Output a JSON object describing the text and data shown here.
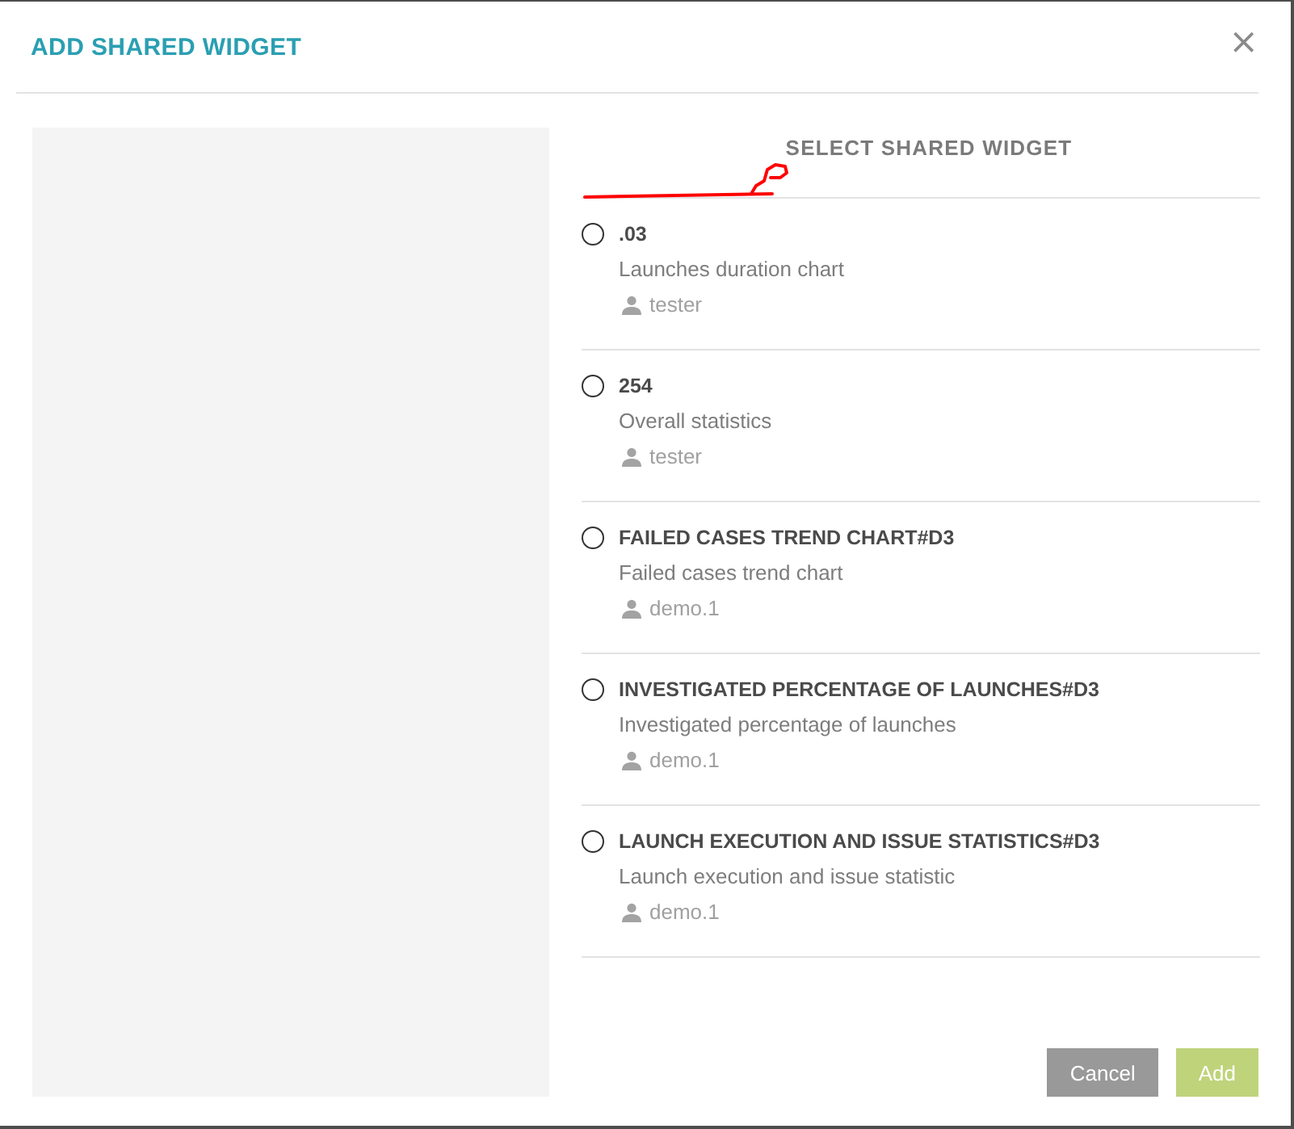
{
  "dialog": {
    "title": "ADD SHARED WIDGET",
    "close": "×"
  },
  "widget_list": {
    "heading": "SELECT SHARED WIDGET",
    "items": [
      {
        "name": ".03",
        "description": "Launches duration chart",
        "owner": "tester",
        "selected": false
      },
      {
        "name": "254",
        "description": "Overall statistics",
        "owner": "tester",
        "selected": false
      },
      {
        "name": "FAILED CASES TREND CHART#D3",
        "description": "Failed cases trend chart",
        "owner": "demo.1",
        "selected": false
      },
      {
        "name": "INVESTIGATED PERCENTAGE OF LAUNCHES#D3",
        "description": "Investigated percentage of launches",
        "owner": "demo.1",
        "selected": false
      },
      {
        "name": "LAUNCH EXECUTION AND ISSUE STATISTICS#D3",
        "description": "Launch execution and issue statistic",
        "owner": "demo.1",
        "selected": false
      }
    ]
  },
  "buttons": [
    {
      "label": "Cancel",
      "kind": "secondary"
    },
    {
      "label": "Add",
      "kind": "primary"
    }
  ]
}
